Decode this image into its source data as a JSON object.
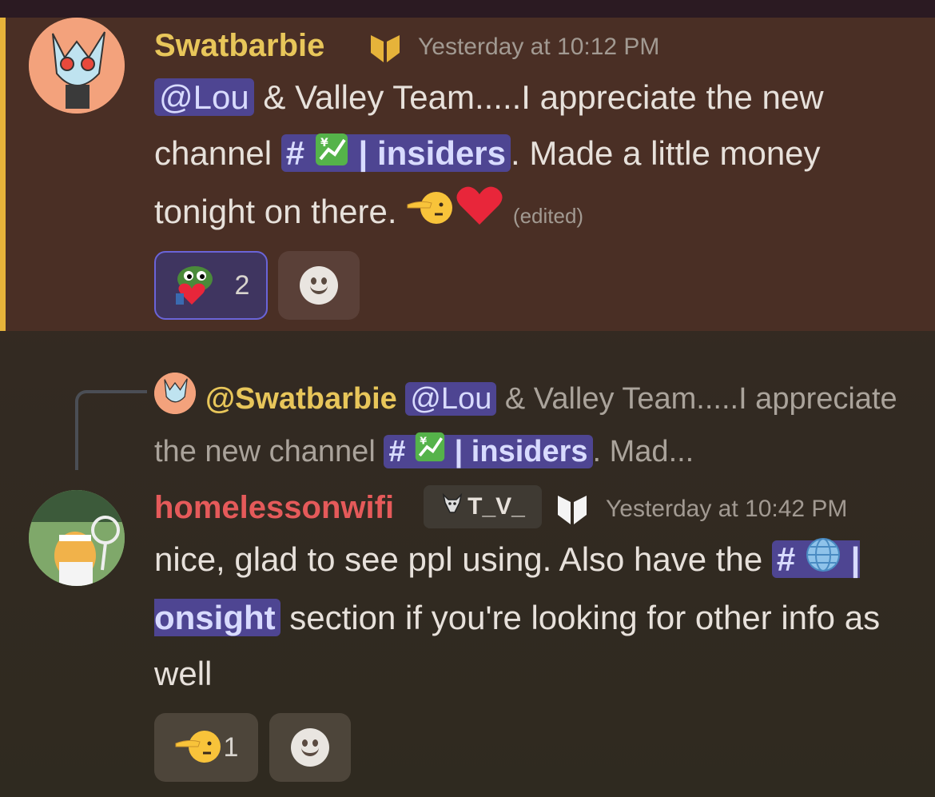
{
  "messages": [
    {
      "username": "Swatbarbie",
      "timestamp": "Yesterday at 10:12 PM",
      "mention": "@Lou",
      "text_1": " & Valley Team.....I appreciate the new channel ",
      "channel_hash": "#",
      "channel_sep": "|",
      "channel_name": "insiders",
      "text_2": ". Made a little money tonight on there. ",
      "edited": "(edited)",
      "reactions": [
        {
          "emoji": "pepe-heart",
          "count": "2"
        },
        {
          "emoji": "add-reaction",
          "count": ""
        }
      ]
    },
    {
      "reply": {
        "username": "@Swatbarbie",
        "mention": "@Lou",
        "text_1": " & Valley Team.....I appreciate the new channel ",
        "channel_hash": "#",
        "channel_sep": "|",
        "channel_name": "insiders",
        "text_2": ". Mad..."
      },
      "username": "homelessonwifi",
      "badge": "T_V_",
      "timestamp": "Yesterday at 10:42 PM",
      "text_1": "nice, glad to see ppl using. Also have the ",
      "channel_hash": "#",
      "channel_sep": "|",
      "channel_name": "onsight",
      "text_2": " section if you're looking for other info as well",
      "reactions": [
        {
          "emoji": "saluting-face",
          "count": "1"
        },
        {
          "emoji": "add-reaction",
          "count": ""
        }
      ]
    }
  ],
  "colors": {
    "accent_gold": "#e6b33a",
    "mention_bg": "#4e4592",
    "username_1": "#e8c65a",
    "username_2": "#e55a5a"
  }
}
